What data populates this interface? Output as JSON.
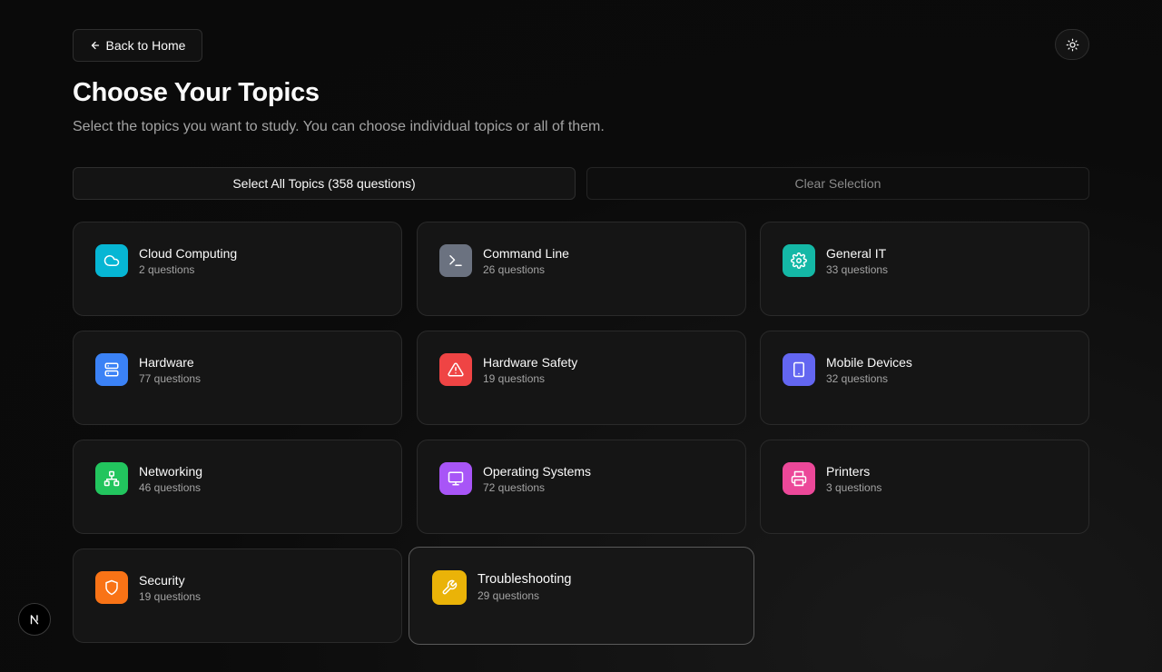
{
  "header": {
    "back_label": "Back to Home",
    "title": "Choose Your Topics",
    "subtitle": "Select the topics you want to study. You can choose individual topics or all of them."
  },
  "actions": {
    "select_all_label": "Select All Topics (358 questions)",
    "clear_label": "Clear Selection"
  },
  "topics": [
    {
      "name": "Cloud Computing",
      "count": "2 questions",
      "icon": "cloud-icon",
      "color": "#06b6d4"
    },
    {
      "name": "Command Line",
      "count": "26 questions",
      "icon": "terminal-icon",
      "color": "#6b7280"
    },
    {
      "name": "General IT",
      "count": "33 questions",
      "icon": "gear-icon",
      "color": "#14b8a6"
    },
    {
      "name": "Hardware",
      "count": "77 questions",
      "icon": "server-icon",
      "color": "#3b82f6"
    },
    {
      "name": "Hardware Safety",
      "count": "19 questions",
      "icon": "warning-icon",
      "color": "#ef4444"
    },
    {
      "name": "Mobile Devices",
      "count": "32 questions",
      "icon": "tablet-icon",
      "color": "#6366f1"
    },
    {
      "name": "Networking",
      "count": "46 questions",
      "icon": "network-icon",
      "color": "#22c55e"
    },
    {
      "name": "Operating Systems",
      "count": "72 questions",
      "icon": "monitor-icon",
      "color": "#a855f7"
    },
    {
      "name": "Printers",
      "count": "3 questions",
      "icon": "printer-icon",
      "color": "#ec4899"
    },
    {
      "name": "Security",
      "count": "19 questions",
      "icon": "shield-icon",
      "color": "#f97316"
    },
    {
      "name": "Troubleshooting",
      "count": "29 questions",
      "icon": "wrench-icon",
      "color": "#eab308"
    }
  ],
  "icons": {
    "back": "arrow-left-icon",
    "theme": "sun-icon",
    "nav": "next-logo-icon"
  }
}
